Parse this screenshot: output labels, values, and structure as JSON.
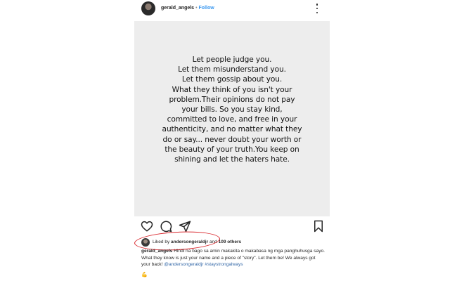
{
  "header": {
    "username": "gerald_angels",
    "separator": "•",
    "follow_label": "Follow"
  },
  "photo": {
    "quote_lines": [
      "Let people judge you.",
      "Let them misunderstand you.",
      "Let them gossip about you.",
      "What they think of you isn't your",
      "problem.Their opinions do not pay",
      "your bills. So you stay kind,",
      "committed to love, and free in your",
      "authenticity, and no matter what they",
      "do or say... never doubt your worth or",
      "the beauty of your truth.You keep on",
      "shining and let the haters hate."
    ]
  },
  "actions": {
    "icons": [
      "heart-icon",
      "comment-icon",
      "share-icon",
      "bookmark-icon"
    ]
  },
  "likes": {
    "prefix": "Liked by ",
    "user": "andersongeraldjr",
    "middle": " and ",
    "others": "109 others"
  },
  "caption": {
    "username": "gerald_angels",
    "text1": "Hindi na bago sa amin makakita o makabasa ng mga panghuhusga sayo. What they know is just your name and a piece of \"story\". Let them be! We always got your back! ",
    "mention": "@andersongeraldjr",
    "hashtag": "#staystrongalways",
    "emoji": "💪"
  },
  "colors": {
    "link": "#3897f0",
    "annotation": "#d9262c",
    "photo_bg": "#ededed"
  }
}
